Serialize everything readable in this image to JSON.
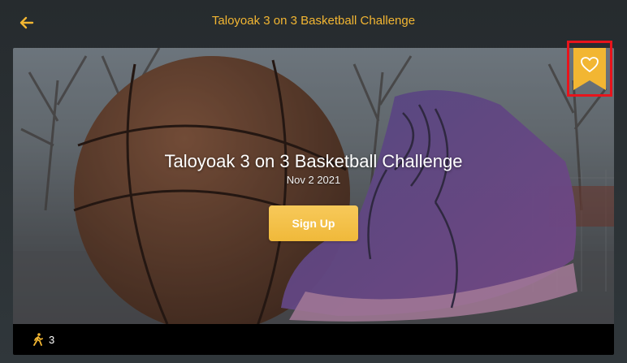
{
  "header": {
    "title": "Taloyoak 3 on 3 Basketball Challenge",
    "back_icon": "arrow-left-icon"
  },
  "event": {
    "title": "Taloyoak 3 on 3 Basketball Challenge",
    "date": "Nov 2 2021",
    "signup_label": "Sign Up",
    "bookmark_icon": "heart-bookmark-icon",
    "participants_icon": "walking-person-icon",
    "participants_count": "3"
  },
  "colors": {
    "accent": "#f2b632",
    "bookmark": "#f2b632",
    "highlight": "#e8141c",
    "background": "#2e3438"
  }
}
